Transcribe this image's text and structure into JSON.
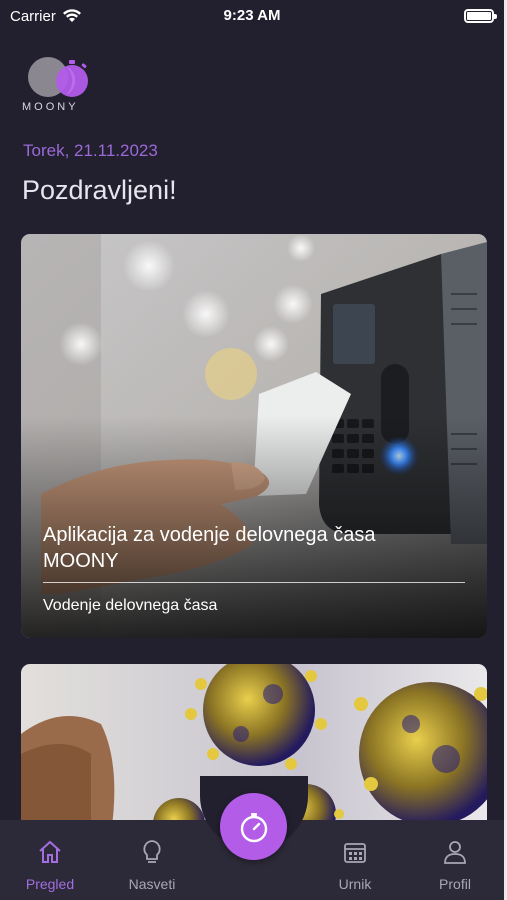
{
  "status_bar": {
    "carrier": "Carrier",
    "time": "9:23 AM"
  },
  "brand": {
    "name": "MOONY"
  },
  "header": {
    "date": "Torek, 21.11.2023",
    "greeting": "Pozdravljeni!"
  },
  "cards": [
    {
      "title": "Aplikacija za vodenje delovnega časa MOONY",
      "category": "Vodenje delovnega časa"
    }
  ],
  "tab_bar": {
    "items": [
      {
        "label": "Pregled",
        "icon": "home-icon",
        "active": true
      },
      {
        "label": "Nasveti",
        "icon": "lightbulb-icon",
        "active": false
      },
      {
        "label": "Urnik",
        "icon": "calendar-icon",
        "active": false
      },
      {
        "label": "Profil",
        "icon": "user-icon",
        "active": false
      }
    ],
    "center_button_icon": "stopwatch-icon"
  },
  "colors": {
    "background": "#221f2e",
    "accent": "#a46ee0",
    "fab": "#b25ce8",
    "tab_bar": "#2c2938"
  }
}
